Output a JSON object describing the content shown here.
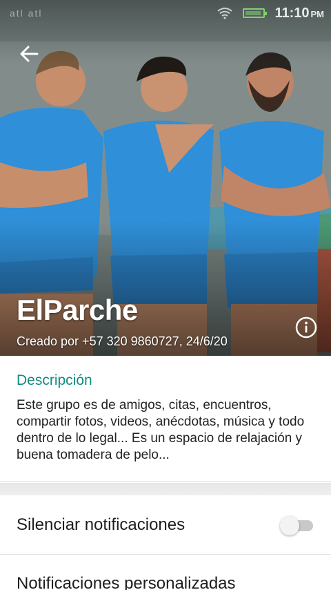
{
  "status_bar": {
    "carrier": "atl atl",
    "time": "11:10",
    "ampm": "PM"
  },
  "header": {
    "back_icon": "arrow-back-icon",
    "group_name": "ElParche",
    "created_by": "Creado por +57 320 9860727, 24/6/20",
    "info_icon": "info-icon"
  },
  "description": {
    "title": "Descripción",
    "text": "Este grupo es de amigos, citas, encuentros, compartir fotos, videos, anécdotas, música y todo dentro de lo legal... Es un espacio de relajación y buena tomadera de pelo..."
  },
  "settings": {
    "mute_label": "Silenciar notificaciones",
    "mute_on": false,
    "custom_label": "Notificaciones personalizadas"
  },
  "colors": {
    "accent": "#128c7e",
    "jersey": "#2f8fd8"
  }
}
